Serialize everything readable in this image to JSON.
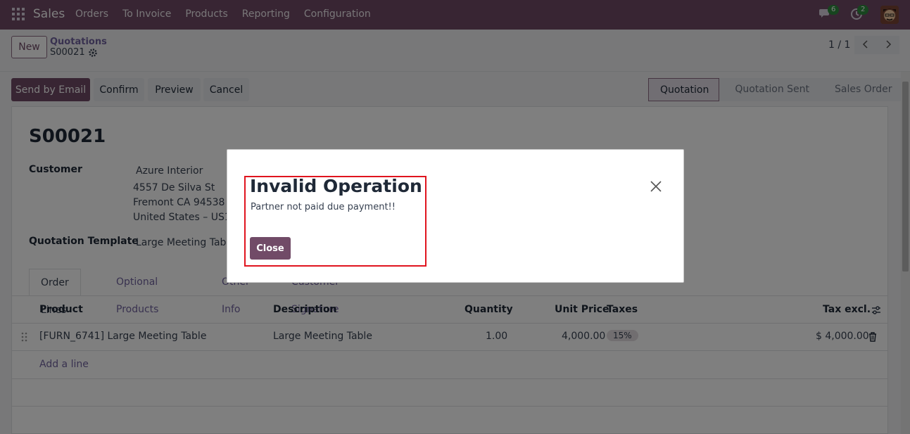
{
  "navbar": {
    "brand": "Sales",
    "menu": [
      "Orders",
      "To Invoice",
      "Products",
      "Reporting",
      "Configuration"
    ],
    "chat_count": "6",
    "activity_count": "2"
  },
  "control": {
    "new_label": "New",
    "breadcrumb_parent": "Quotations",
    "breadcrumb_current": "S00021",
    "pager": "1 / 1"
  },
  "actions": {
    "send_email": "Send by Email",
    "confirm": "Confirm",
    "preview": "Preview",
    "cancel": "Cancel"
  },
  "statusbar": [
    "Quotation",
    "Quotation Sent",
    "Sales Order"
  ],
  "form": {
    "name": "S00021",
    "customer_label": "Customer",
    "customer_name": "Azure Interior",
    "address_line1": "4557 De Silva St",
    "address_line2": "Fremont CA 94538",
    "address_line3": "United States – US12",
    "template_label": "Quotation Template",
    "template_value": "Large Meeting Table",
    "tabs": [
      "Order Lines",
      "Optional Products",
      "Other Info",
      "Customer Signature"
    ]
  },
  "table": {
    "headers": {
      "product": "Product",
      "description": "Description",
      "quantity": "Quantity",
      "unit_price": "Unit Price",
      "taxes": "Taxes",
      "tax_excl": "Tax excl."
    },
    "rows": [
      {
        "product": "[FURN_6741] Large Meeting Table",
        "description": "Large Meeting Table",
        "quantity": "1.00",
        "unit_price": "4,000.00",
        "taxes": "15%",
        "tax_excl": "$ 4,000.00"
      }
    ],
    "add_line": "Add a line"
  },
  "modal": {
    "title": "Invalid Operation",
    "message": "Partner not paid due payment!!",
    "close_label": "Close"
  },
  "colors": {
    "brand": "#714b67",
    "link": "#71639e",
    "highlight": "#e0141e"
  }
}
